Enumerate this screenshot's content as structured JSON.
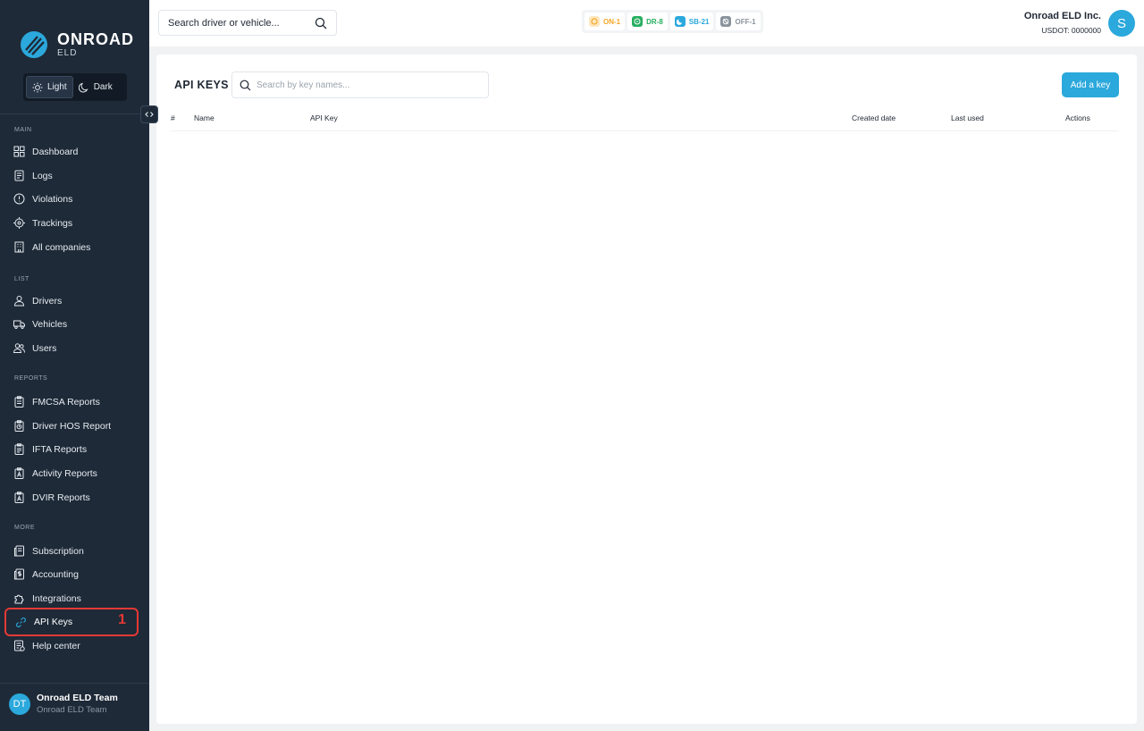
{
  "sidebar": {
    "logo": {
      "name": "ONROAD",
      "sub": "ELD"
    },
    "theme": {
      "light": "Light",
      "dark": "Dark"
    },
    "sections": {
      "main": "MAIN",
      "list": "LIST",
      "reports": "REPORTS",
      "more": "MORE"
    },
    "items": {
      "dashboard": "Dashboard",
      "logs": "Logs",
      "violations": "Violations",
      "trackings": "Trackings",
      "all_companies": "All companies",
      "drivers": "Drivers",
      "vehicles": "Vehicles",
      "users": "Users",
      "fmcsa_reports": "FMCSA Reports",
      "driver_hos_report": "Driver HOS Report",
      "ifta_reports": "IFTA Reports",
      "activity_reports": "Activity Reports",
      "dvir_reports": "DVIR Reports",
      "subscription": "Subscription",
      "accounting": "Accounting",
      "integrations": "Integrations",
      "api_keys": "API Keys",
      "help_center": "Help center"
    },
    "active_badge": "1",
    "user": {
      "initials": "DT",
      "name": "Onroad ELD Team",
      "role": "Onroad ELD Team"
    }
  },
  "topbar": {
    "search_placeholder": "Search driver or vehicle...",
    "statuses": [
      {
        "label": "ON-1",
        "color": "#f5a623"
      },
      {
        "label": "DR-8",
        "color": "#27ae60"
      },
      {
        "label": "SB-21",
        "color": "#2ba8dc"
      },
      {
        "label": "OFF-1",
        "color": "#8a939c"
      }
    ],
    "company": {
      "name": "Onroad ELD Inc.",
      "usdot": "USDOT: 0000000"
    },
    "avatar_initial": "S"
  },
  "main": {
    "title": "API KEYS",
    "search_placeholder": "Search by key names...",
    "add_button": "Add a key",
    "columns": [
      "#",
      "Name",
      "API Key",
      "Created date",
      "Last used",
      "Actions"
    ],
    "rows": []
  },
  "colors": {
    "sidebar_bg": "#1e2a38",
    "accent": "#2ba8dc",
    "highlight": "#e53935"
  }
}
